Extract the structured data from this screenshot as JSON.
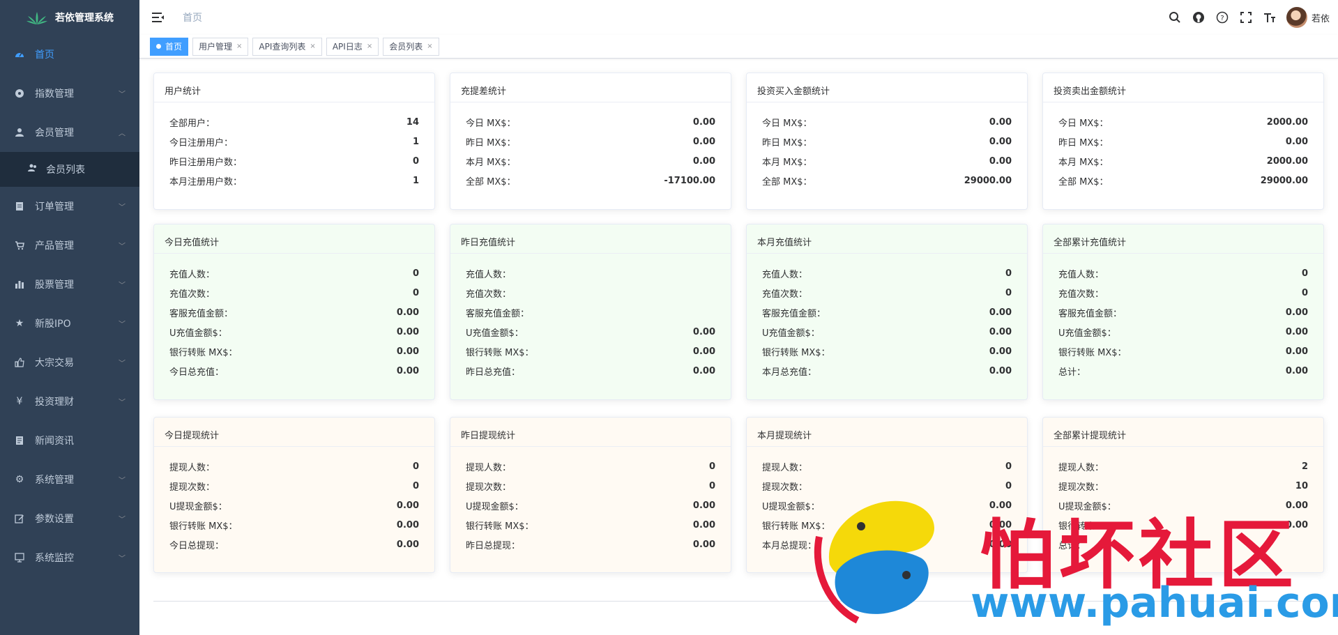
{
  "app": {
    "title": "若依管理系统"
  },
  "sidebar": {
    "items": [
      {
        "label": "首页",
        "icon": "dashboard-icon",
        "active": true
      },
      {
        "label": "指数管理",
        "icon": "compass-icon"
      },
      {
        "label": "会员管理",
        "icon": "user-icon",
        "expanded": true
      },
      {
        "label": "订单管理",
        "icon": "document-icon"
      },
      {
        "label": "产品管理",
        "icon": "cart-icon"
      },
      {
        "label": "股票管理",
        "icon": "bar-chart-icon"
      },
      {
        "label": "新股IPO",
        "icon": "star-icon"
      },
      {
        "label": "大宗交易",
        "icon": "thumb-icon"
      },
      {
        "label": "投资理财",
        "icon": "yen-icon"
      },
      {
        "label": "新闻资讯",
        "icon": "news-icon"
      },
      {
        "label": "系统管理",
        "icon": "gear-icon"
      },
      {
        "label": "参数设置",
        "icon": "edit-icon"
      },
      {
        "label": "系统监控",
        "icon": "monitor-icon"
      }
    ],
    "subitem": {
      "label": "会员列表",
      "icon": "users-icon"
    }
  },
  "navbar": {
    "breadcrumb": "首页",
    "username": "若依"
  },
  "tags": [
    {
      "label": "首页",
      "active": true
    },
    {
      "label": "用户管理"
    },
    {
      "label": "API查询列表"
    },
    {
      "label": "API日志"
    },
    {
      "label": "会员列表"
    }
  ],
  "cards": [
    {
      "title": "用户统计",
      "rows": [
        [
          "全部用户：",
          "14"
        ],
        [
          "今日注册用户：",
          "1"
        ],
        [
          "昨日注册用户数：",
          "0"
        ],
        [
          "本月注册用户数：",
          "1"
        ]
      ]
    },
    {
      "title": "充提差统计",
      "rows": [
        [
          "今日 MX$：",
          "0.00"
        ],
        [
          "昨日 MX$：",
          "0.00"
        ],
        [
          "本月 MX$：",
          "0.00"
        ],
        [
          "全部 MX$：",
          "-17100.00"
        ]
      ]
    },
    {
      "title": "投资买入金额统计",
      "rows": [
        [
          "今日 MX$：",
          "0.00"
        ],
        [
          "昨日 MX$：",
          "0.00"
        ],
        [
          "本月 MX$：",
          "0.00"
        ],
        [
          "全部 MX$：",
          "29000.00"
        ]
      ]
    },
    {
      "title": "投资卖出金额统计",
      "rows": [
        [
          "今日 MX$：",
          "2000.00"
        ],
        [
          "昨日 MX$：",
          "0.00"
        ],
        [
          "本月 MX$：",
          "2000.00"
        ],
        [
          "全部 MX$：",
          "29000.00"
        ]
      ]
    },
    {
      "title": "今日充值统计",
      "rows": [
        [
          "充值人数：",
          "0"
        ],
        [
          "充值次数：",
          "0"
        ],
        [
          "客服充值金额：",
          "0.00"
        ],
        [
          "U充值金额$：",
          "0.00"
        ],
        [
          "银行转账 MX$：",
          "0.00"
        ],
        [
          "今日总充值：",
          "0.00"
        ]
      ]
    },
    {
      "title": "昨日充值统计",
      "rows": [
        [
          "充值人数：",
          ""
        ],
        [
          "充值次数：",
          ""
        ],
        [
          "客服充值金额：",
          ""
        ],
        [
          "U充值金额$：",
          "0.00"
        ],
        [
          "银行转账 MX$：",
          "0.00"
        ],
        [
          "昨日总充值：",
          "0.00"
        ]
      ]
    },
    {
      "title": "本月充值统计",
      "rows": [
        [
          "充值人数：",
          "0"
        ],
        [
          "充值次数：",
          "0"
        ],
        [
          "客服充值金额：",
          "0.00"
        ],
        [
          "U充值金额$：",
          "0.00"
        ],
        [
          "银行转账 MX$：",
          "0.00"
        ],
        [
          "本月总充值：",
          "0.00"
        ]
      ]
    },
    {
      "title": "全部累计充值统计",
      "rows": [
        [
          "充值人数：",
          "0"
        ],
        [
          "充值次数：",
          "0"
        ],
        [
          "客服充值金额：",
          "0.00"
        ],
        [
          "U充值金额$：",
          "0.00"
        ],
        [
          "银行转账 MX$：",
          "0.00"
        ],
        [
          "总计：",
          "0.00"
        ]
      ]
    },
    {
      "title": "今日提现统计",
      "rows": [
        [
          "提现人数：",
          "0"
        ],
        [
          "提现次数：",
          "0"
        ],
        [
          "U提现金额$：",
          "0.00"
        ],
        [
          "银行转账 MX$：",
          "0.00"
        ],
        [
          "今日总提现：",
          "0.00"
        ]
      ]
    },
    {
      "title": "昨日提现统计",
      "rows": [
        [
          "提现人数：",
          "0"
        ],
        [
          "提现次数：",
          "0"
        ],
        [
          "U提现金额$：",
          "0.00"
        ],
        [
          "银行转账 MX$：",
          "0.00"
        ],
        [
          "昨日总提现：",
          "0.00"
        ]
      ]
    },
    {
      "title": "本月提现统计",
      "rows": [
        [
          "提现人数：",
          "0"
        ],
        [
          "提现次数：",
          "0"
        ],
        [
          "U提现金额$：",
          "0.00"
        ],
        [
          "银行转账 MX$：",
          "0.00"
        ],
        [
          "本月总提现：",
          "0.00"
        ]
      ]
    },
    {
      "title": "全部累计提现统计",
      "rows": [
        [
          "提现人数：",
          "2"
        ],
        [
          "提现次数：",
          "10"
        ],
        [
          "U提现金额$：",
          "0.00"
        ],
        [
          "银行转账 MX$：",
          "0.00"
        ],
        [
          "总计：",
          ""
        ]
      ]
    }
  ],
  "watermark": {
    "text": "怕坏社区",
    "url": "www.pahuai.com"
  },
  "colors": {
    "sidebar_bg": "#304156",
    "active": "#409eff",
    "green_card": "#f3fdf3",
    "peach_card": "#fffaf3"
  }
}
